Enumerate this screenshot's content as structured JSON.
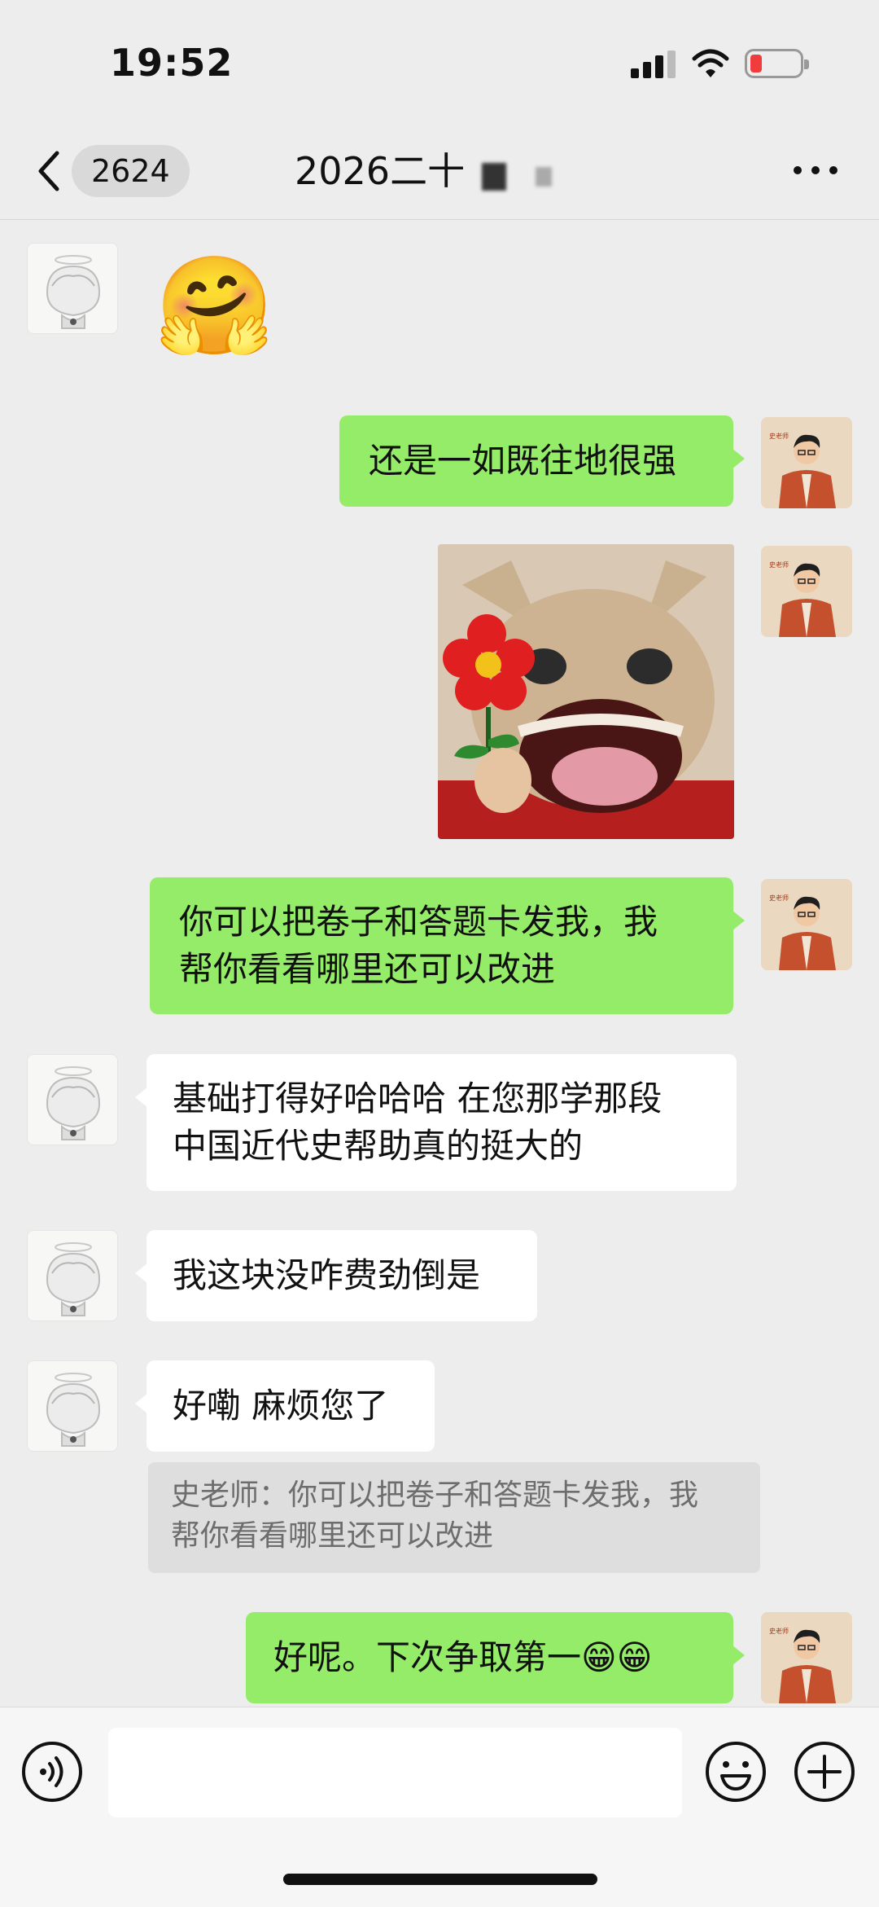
{
  "status_bar": {
    "time": "19:52"
  },
  "nav": {
    "unread_count": "2624",
    "title": "2026二十",
    "icons": [
      "chevron-left-icon",
      "more-icon"
    ]
  },
  "messages": [
    {
      "from": "friend",
      "type": "emoji",
      "emoji": "🤗"
    },
    {
      "from": "me",
      "type": "text",
      "text": "还是一如既往地很强"
    },
    {
      "from": "me",
      "type": "sticker",
      "sticker": "cat-holding-red-flower"
    },
    {
      "from": "me",
      "type": "text",
      "lines": [
        "你可以把卷子和答题卡发我，我",
        "帮你看看哪里还可以改进"
      ]
    },
    {
      "from": "friend",
      "type": "text",
      "lines": [
        "基础打得好哈哈哈 在您那学那段",
        "中国近代史帮助真的挺大的"
      ]
    },
    {
      "from": "friend",
      "type": "text",
      "text": "我这块没咋费劲倒是"
    },
    {
      "from": "friend",
      "type": "text",
      "text": "好嘞 麻烦您了"
    },
    {
      "from": "quote",
      "type": "quote",
      "lines": [
        "史老师：你可以把卷子和答题卡发我，我",
        "帮你看看哪里还可以改进"
      ]
    },
    {
      "from": "me",
      "type": "text",
      "text": "好呢。下次争取第一😁😁"
    }
  ],
  "input_bar": {
    "placeholder": "",
    "icons": [
      "voice-icon",
      "emoji-icon",
      "plus-icon"
    ]
  },
  "colors": {
    "background": "#ededed",
    "my_bubble": "#95ec69",
    "friend_bubble": "#ffffff",
    "quote_block": "#dedede"
  }
}
